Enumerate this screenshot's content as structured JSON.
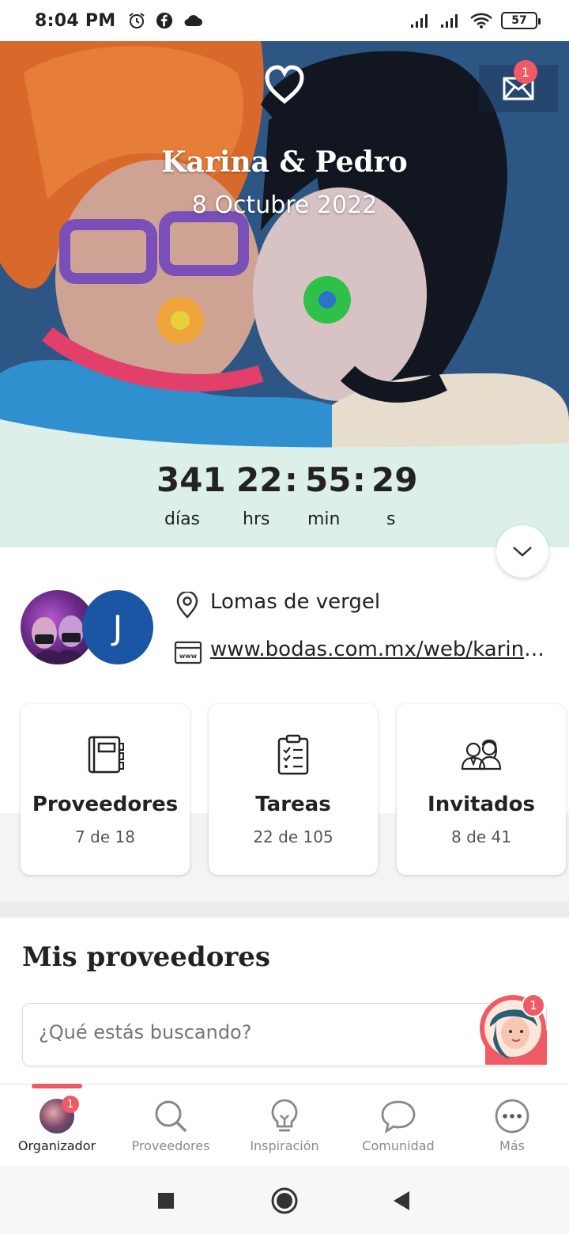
{
  "status_bar": {
    "time": "8:04 PM",
    "battery": "57"
  },
  "hero": {
    "couple_name": "Karina & Pedro",
    "date": "8 Octubre 2022",
    "mail_badge": "1"
  },
  "countdown": {
    "days": "341",
    "days_label": "días",
    "hours": "22",
    "hours_label": "hrs",
    "sep1": ":",
    "minutes": "55",
    "minutes_label": "min",
    "sep2": ":",
    "seconds": "29",
    "seconds_label": "s"
  },
  "info": {
    "avatar_initial": "J",
    "location": "Lomas de vergel",
    "website": "www.bodas.com.mx/web/karina..."
  },
  "stats": [
    {
      "title": "Proveedores",
      "count": "7 de 18",
      "icon": "notebook-icon"
    },
    {
      "title": "Tareas",
      "count": "22 de 105",
      "icon": "clipboard-checklist-icon"
    },
    {
      "title": "Invitados",
      "count": "8 de 41",
      "icon": "guests-icon"
    }
  ],
  "providers_section": {
    "title": "Mis proveedores",
    "search_placeholder": "¿Qué estás buscando?",
    "assistant_badge": "1"
  },
  "bottom_nav": [
    {
      "label": "Organizador",
      "active": true,
      "badge": "1"
    },
    {
      "label": "Proveedores"
    },
    {
      "label": "Inspiración"
    },
    {
      "label": "Comunidad"
    },
    {
      "label": "Más"
    }
  ],
  "colors": {
    "accent": "#ef5b64",
    "mint": "#dcefe9",
    "brand_blue": "#1a56a3"
  }
}
